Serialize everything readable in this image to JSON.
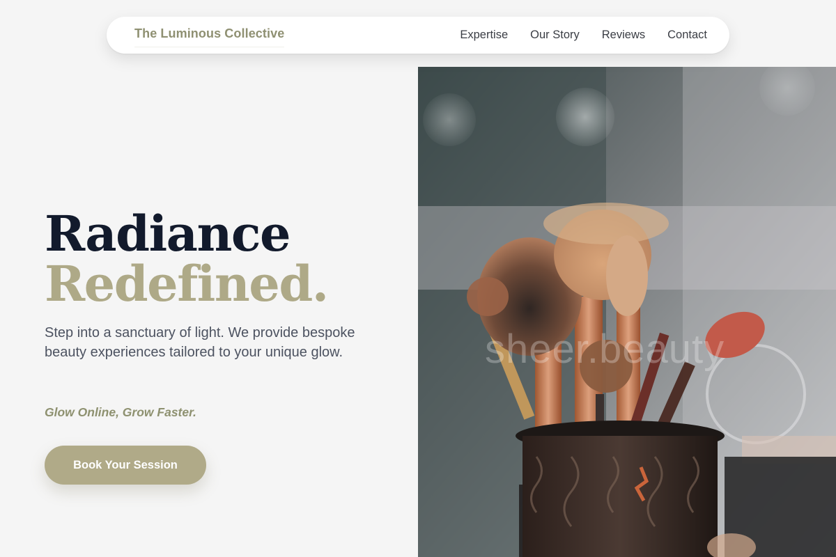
{
  "nav": {
    "brand": "The Luminous Collective",
    "links": [
      "Expertise",
      "Our Story",
      "Reviews",
      "Contact"
    ]
  },
  "hero": {
    "title_line1": "Radiance",
    "title_line2": "Redefined.",
    "description": "Step into a sanctuary of light. We provide bespoke beauty experiences tailored to your unique glow.",
    "tagline": "Glow Online, Grow Faster.",
    "cta_label": "Book Your Session"
  },
  "image": {
    "watermark": "sheer.beauty"
  },
  "colors": {
    "background": "#f5f5f5",
    "accent": "#b0aa88",
    "title_dark": "#121a2c",
    "title_accent": "#aea987",
    "tagline": "#8e9170",
    "brand": "#8f9072"
  }
}
